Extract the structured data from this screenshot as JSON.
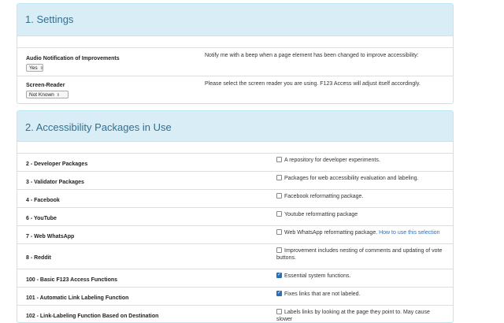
{
  "settings": {
    "heading": "1. Settings",
    "rows": [
      {
        "label": "Audio Notification of Improvements",
        "select_value": "Yes",
        "description": "Notify me with a beep when a page element has been changed to improve accessibility:"
      },
      {
        "label": "Screen-Reader",
        "select_value": "Not Known",
        "description": "Please select the screen reader you are using. F123 Access will adjust itself accordingly."
      }
    ]
  },
  "packages": {
    "heading": "2. Accessibility Packages in Use",
    "rows": [
      {
        "label": "2 - Developer Packages",
        "checked": false,
        "description": "A repository for developer experiments.",
        "link": ""
      },
      {
        "label": "3 - Validator Packages",
        "checked": false,
        "description": "Packages for web accessibility evaluation and labeling.",
        "link": ""
      },
      {
        "label": "4 - Facebook",
        "checked": false,
        "description": "Facebook reformatting package.",
        "link": ""
      },
      {
        "label": "6 - YouTube",
        "checked": false,
        "description": "Youtube reformatting package",
        "link": ""
      },
      {
        "label": "7 - Web WhatsApp",
        "checked": false,
        "description": "Web WhatsApp reformatting package.",
        "link": "How to use this selection"
      },
      {
        "label": "8 - Reddit",
        "checked": false,
        "description": "Improvement includes nesting of comments and updating of vote buttons.",
        "link": ""
      },
      {
        "label": "100 - Basic F123 Access Functions",
        "checked": true,
        "description": "Essential system functions.",
        "link": ""
      },
      {
        "label": "101 - Automatic Link Labeling Function",
        "checked": true,
        "description": "Fixes links that are not labeled.",
        "link": ""
      },
      {
        "label": "102 - Link-Labeling Function Based on Destination",
        "checked": false,
        "description": "Labels links by looking at the page they point to. May cause slower",
        "link": ""
      }
    ]
  },
  "colors": {
    "heading_bg": "#d9edf7",
    "heading_text": "#31708f",
    "border": "#bce8f1",
    "link": "#2a6ebb"
  }
}
